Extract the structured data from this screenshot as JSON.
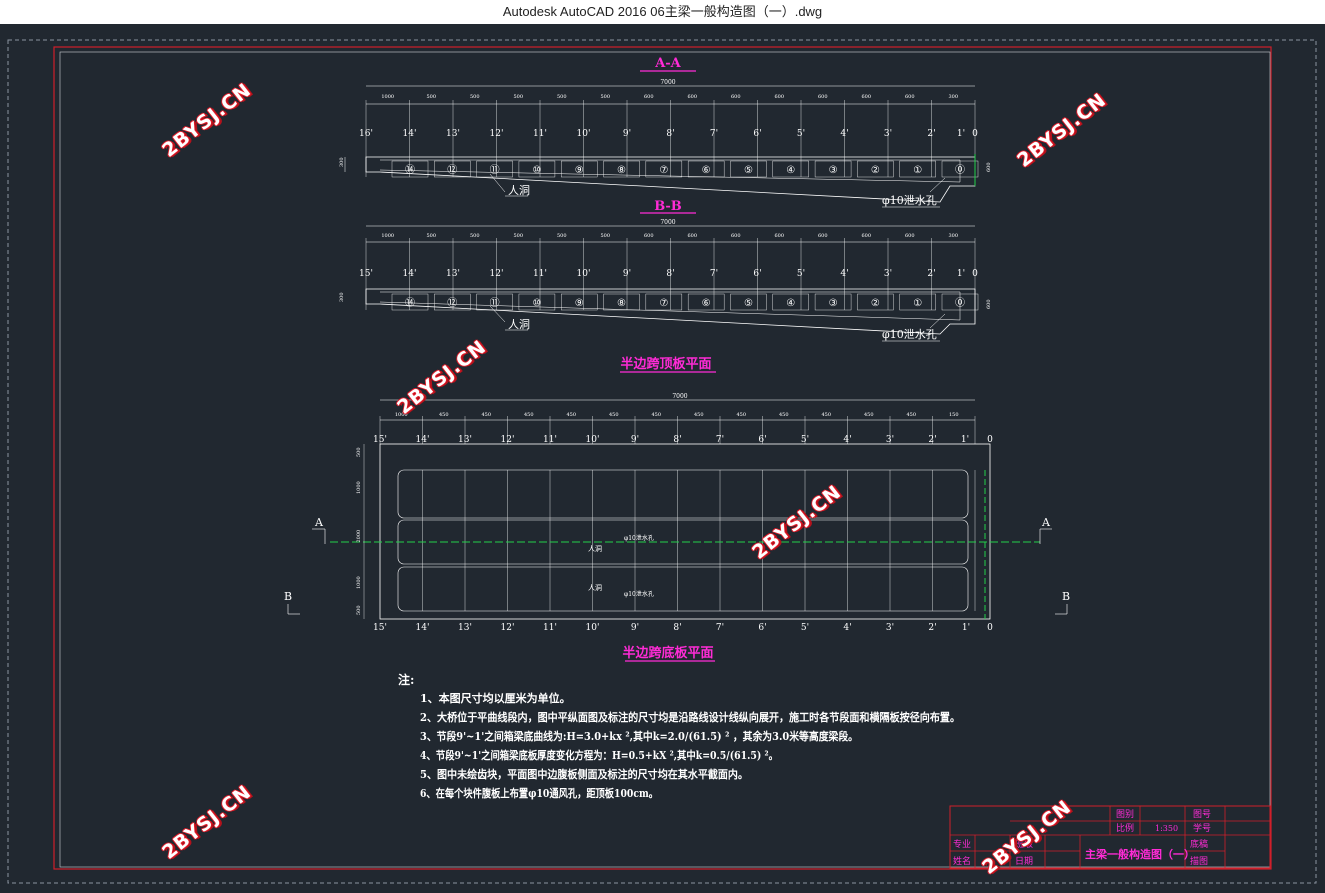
{
  "window": {
    "title": "Autodesk AutoCAD 2016     06主梁一般构造图（一）.dwg"
  },
  "colors": {
    "background": "#212830",
    "frame": "#d01f2a",
    "line": "#ffffff",
    "magenta": "#ff2bd6",
    "green": "#22d14a",
    "watermark": "#e21d2a"
  },
  "watermark": {
    "text": "2BYSJ.CN"
  },
  "drawing": {
    "section_aa": {
      "title": "A-A",
      "total_dim": "7000",
      "dims": [
        "1000",
        "500",
        "500",
        "500",
        "500",
        "500",
        "600",
        "600",
        "600",
        "600",
        "600",
        "600",
        "600",
        "300"
      ],
      "segments": [
        "16'",
        "14'",
        "13'",
        "12'",
        "11'",
        "10'",
        "9'",
        "8'",
        "7'",
        "6'",
        "5'",
        "4'",
        "3'",
        "2'",
        "1'",
        "0"
      ],
      "circles": [
        "⑭",
        "⑫",
        "⑪",
        "⑩",
        "⑨",
        "⑧",
        "⑦",
        "⑥",
        "⑤",
        "④",
        "③",
        "②",
        "①",
        "⓪"
      ],
      "label_manhole": "人洞",
      "label_drain": "φ10泄水孔",
      "left_height": "300",
      "right_height": "600"
    },
    "section_bb": {
      "title": "B-B",
      "total_dim": "7000",
      "dims": [
        "1000",
        "500",
        "500",
        "500",
        "500",
        "500",
        "600",
        "600",
        "600",
        "600",
        "600",
        "600",
        "600",
        "300"
      ],
      "segments": [
        "15'",
        "14'",
        "13'",
        "12'",
        "11'",
        "10'",
        "9'",
        "8'",
        "7'",
        "6'",
        "5'",
        "4'",
        "3'",
        "2'",
        "1'",
        "0"
      ],
      "circles": [
        "⑭",
        "⑫",
        "⑪",
        "⑩",
        "⑨",
        "⑧",
        "⑦",
        "⑥",
        "⑤",
        "④",
        "③",
        "②",
        "①",
        "⓪"
      ],
      "label_manhole": "人洞",
      "label_drain": "φ10泄水孔",
      "left_height": "300",
      "right_height": "600"
    },
    "plan": {
      "top_title": "半边跨顶板平面",
      "bottom_title": "半边跨底板平面",
      "total_dim": "7000",
      "dims": [
        "1000",
        "450",
        "450",
        "450",
        "450",
        "450",
        "450",
        "450",
        "450",
        "450",
        "450",
        "450",
        "450",
        "150"
      ],
      "top_segments": [
        "15'",
        "14'",
        "13'",
        "12'",
        "11'",
        "10'",
        "9'",
        "8'",
        "7'",
        "6'",
        "5'",
        "4'",
        "3'",
        "2'",
        "1'",
        "0"
      ],
      "bottom_segments": [
        "15'",
        "14'",
        "13'",
        "12'",
        "11'",
        "10'",
        "9'",
        "8'",
        "7'",
        "6'",
        "5'",
        "4'",
        "3'",
        "2'",
        "1'",
        "0"
      ],
      "label_a": "A",
      "label_b": "B",
      "label_manhole": "人洞",
      "label_drain": "φ10泄水孔",
      "side_dims": [
        "500",
        "1000",
        "2000",
        "1000",
        "500"
      ]
    },
    "notes": {
      "head": "注:",
      "items": [
        "1、本图尺寸均以厘米为单位。",
        "2、大桥位于平曲线段内，图中平纵面图及标注的尺寸均是沿路线设计线纵向展开，施工时各节段面和横隔板按径向布置。",
        "3、节段9'~1'之间箱梁底曲线为:H=3.0+kx ²,其中k=2.0/(61.5) ² ，其余为3.0米等高度梁段。",
        "4、节段9'~1'之间箱梁底板厚度变化方程为：H=0.5+kX ²,其中k=0.5/(61.5) ²。",
        "5、图中未绘齿块，平面图中边腹板侧面及标注的尺寸均在其水平截面内。",
        "6、在每个块件腹板上布置φ10通风孔，距顶板100cm。"
      ]
    },
    "title_block": {
      "drawing_title": "主梁一般构造图（一）",
      "scale_value": "1:350",
      "cells": [
        "图别",
        "比例",
        "图号",
        "学号",
        "专业",
        "班级",
        "审核",
        "日期",
        "姓名",
        "底稿",
        "描图"
      ]
    }
  }
}
